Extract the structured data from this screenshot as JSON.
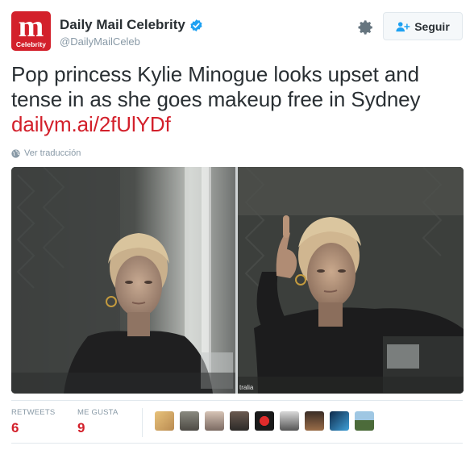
{
  "account": {
    "display_name": "Daily Mail Celebrity",
    "handle": "@DailyMailCeleb",
    "logo_letter": "m",
    "logo_sub": "Celebrity",
    "verified": true
  },
  "actions": {
    "follow_label": "Seguir"
  },
  "tweet": {
    "text": "Pop princess Kylie Minogue looks upset and tense in as she goes makeup free in Sydney",
    "link": "dailym.ai/2fUlYDf"
  },
  "translate_label": "Ver traducción",
  "media": {
    "watermark": "tralia"
  },
  "stats": {
    "retweets_label": "RETWEETS",
    "retweets_value": "6",
    "likes_label": "ME GUSTA",
    "likes_value": "9"
  },
  "colors": {
    "brand_red": "#d3202b",
    "verified_blue": "#1da1f2",
    "secondary_text": "#8899a6"
  },
  "icons": [
    "verified-badge-icon",
    "gear-icon",
    "follow-user-icon",
    "globe-icon"
  ]
}
